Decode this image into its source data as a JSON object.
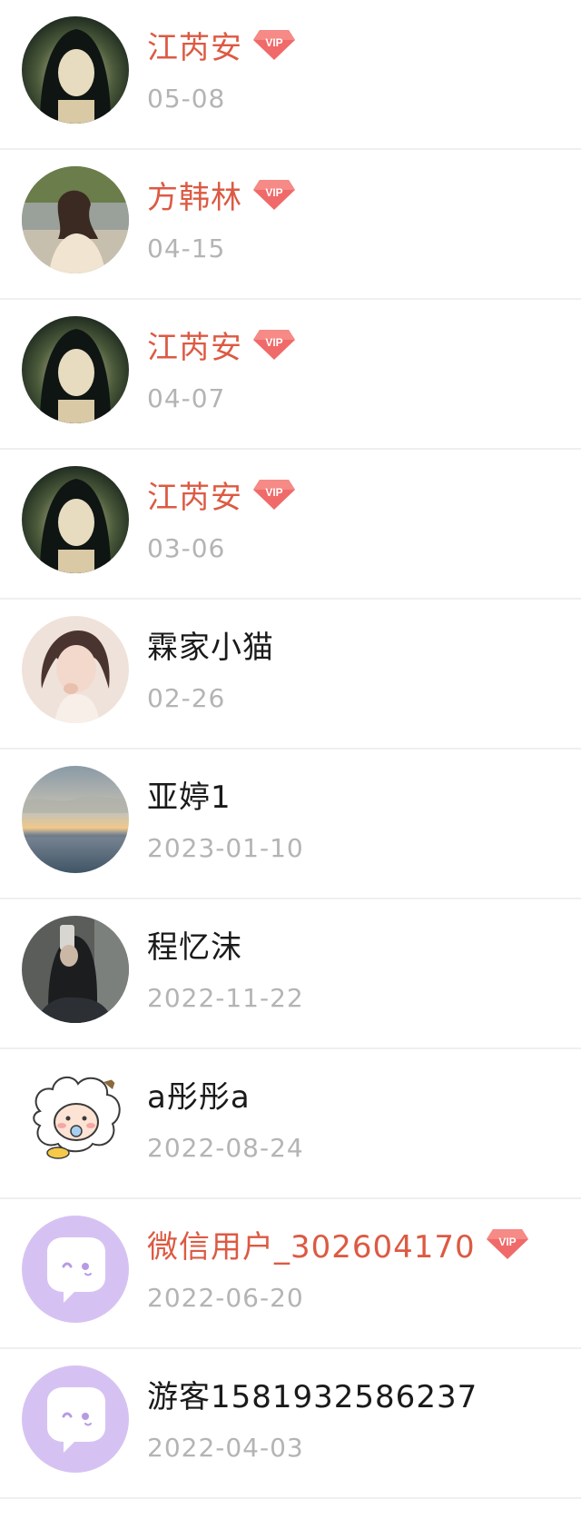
{
  "colors": {
    "vip_name": "#dc5a43",
    "normal_name": "#1a1a1a",
    "date": "#b4b4b4",
    "divider": "#efefef",
    "vip_badge": "#f06a6a",
    "wechat_avatar_bg": "#d6c2f2"
  },
  "users": [
    {
      "name": "江芮安",
      "vip": true,
      "vip_label": "VIP",
      "date": "05-08",
      "avatar": "photo-portrait-dark-hair"
    },
    {
      "name": "方韩林",
      "vip": true,
      "vip_label": "VIP",
      "date": "04-15",
      "avatar": "photo-girl-outdoor"
    },
    {
      "name": "江芮安",
      "vip": true,
      "vip_label": "VIP",
      "date": "04-07",
      "avatar": "photo-portrait-dark-hair"
    },
    {
      "name": "江芮安",
      "vip": true,
      "vip_label": "VIP",
      "date": "03-06",
      "avatar": "photo-portrait-dark-hair"
    },
    {
      "name": "霖家小猫",
      "vip": false,
      "date": "02-26",
      "avatar": "photo-girl-pink"
    },
    {
      "name": "亚婷1",
      "vip": false,
      "date": "2023-01-10",
      "avatar": "photo-sunset-sea"
    },
    {
      "name": "程忆沫",
      "vip": false,
      "date": "2022-11-22",
      "avatar": "photo-selfie-dark"
    },
    {
      "name": "a彤彤a",
      "vip": false,
      "date": "2022-08-24",
      "avatar": "cartoon-sheep"
    },
    {
      "name": "微信用户_302604170",
      "vip": true,
      "vip_label": "VIP",
      "date": "2022-06-20",
      "avatar": "wechat-default-icon"
    },
    {
      "name": "游客1581932586237",
      "vip": false,
      "date": "2022-04-03",
      "avatar": "wechat-default-icon"
    }
  ]
}
